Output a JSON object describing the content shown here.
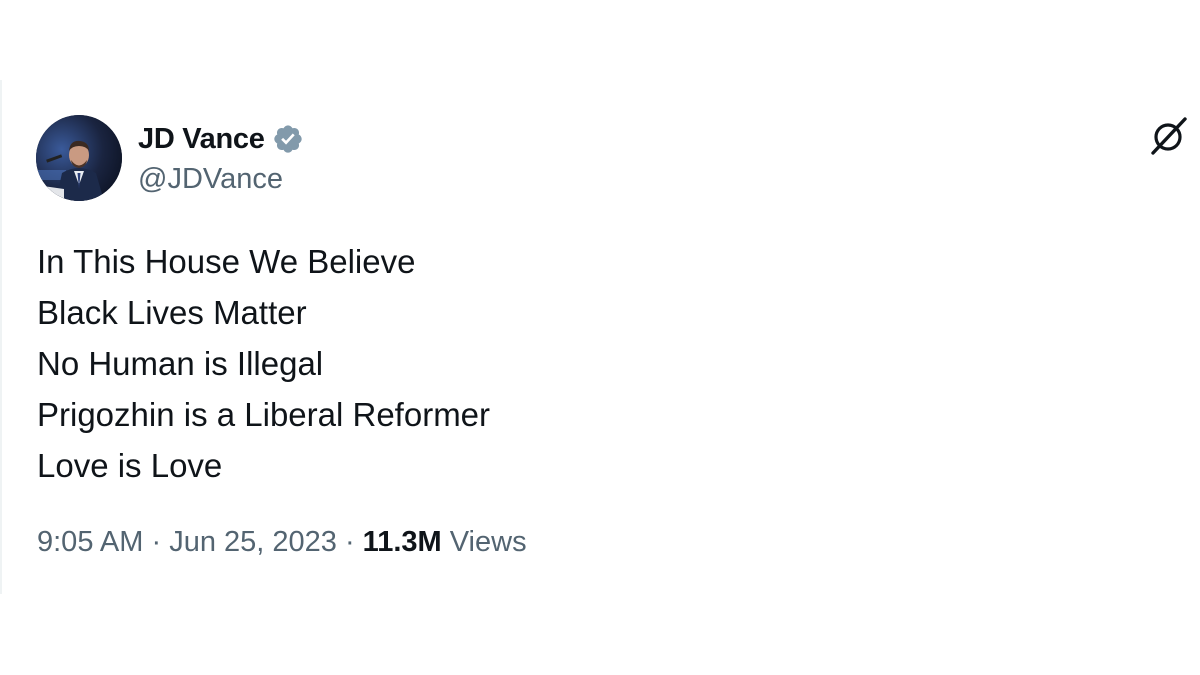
{
  "author": {
    "display_name": "JD Vance",
    "handle": "@JDVance",
    "verified": true,
    "avatar_icon": "profile-photo",
    "verified_icon": "verified-badge-icon",
    "verified_color": "#829aab"
  },
  "platform_icon": "x-logo-icon",
  "tweet": {
    "lines": [
      "In This House We Believe",
      "Black Lives Matter",
      "No Human is Illegal",
      "Prigozhin is a Liberal Reformer",
      "Love is Love"
    ]
  },
  "meta": {
    "time": "9:05 AM",
    "separator": "·",
    "date": "Jun 25, 2023",
    "views_count": "11.3M",
    "views_label": "Views"
  },
  "colors": {
    "text_primary": "#0f1419",
    "text_secondary": "#536471",
    "background": "#ffffff"
  }
}
